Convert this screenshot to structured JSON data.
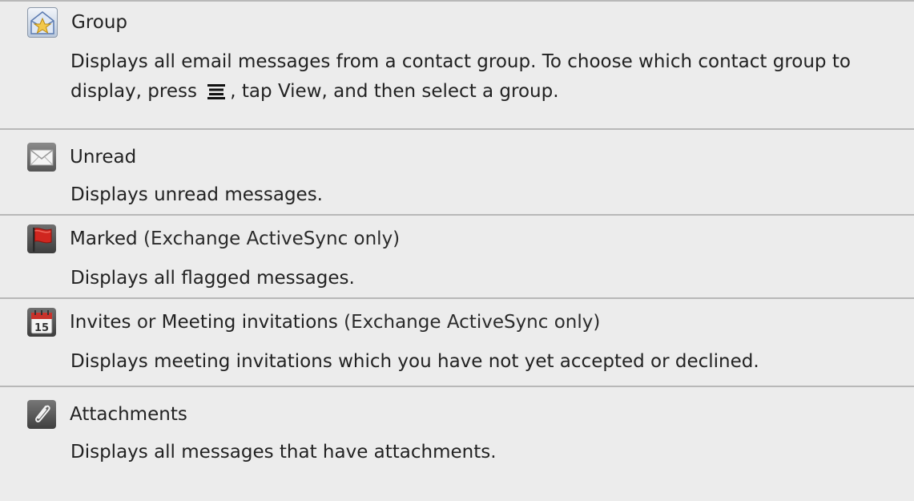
{
  "rows": [
    {
      "icon": "group-star-icon",
      "title": "Group",
      "desc_parts": {
        "p1": "Displays all email messages from a contact group. To choose which contact group to display, press",
        "p2": ", tap",
        "view_label": "View",
        "p3": ", and then select a group."
      }
    },
    {
      "icon": "envelope-icon",
      "title": "Unread",
      "desc": "Displays unread messages."
    },
    {
      "icon": "red-flag-icon",
      "title": "Marked",
      "title_suffix": "(Exchange ActiveSync only)",
      "desc": "Displays all flagged messages."
    },
    {
      "icon": "calendar-icon",
      "icon_text": "15",
      "title": "Invites",
      "or": "or",
      "title2": "Meeting invitations",
      "title_suffix": "(Exchange ActiveSync only)",
      "desc": "Displays meeting invitations which you have not yet accepted or declined."
    },
    {
      "icon": "paperclip-icon",
      "title": "Attachments",
      "desc": "Displays all messages that have attachments."
    }
  ]
}
